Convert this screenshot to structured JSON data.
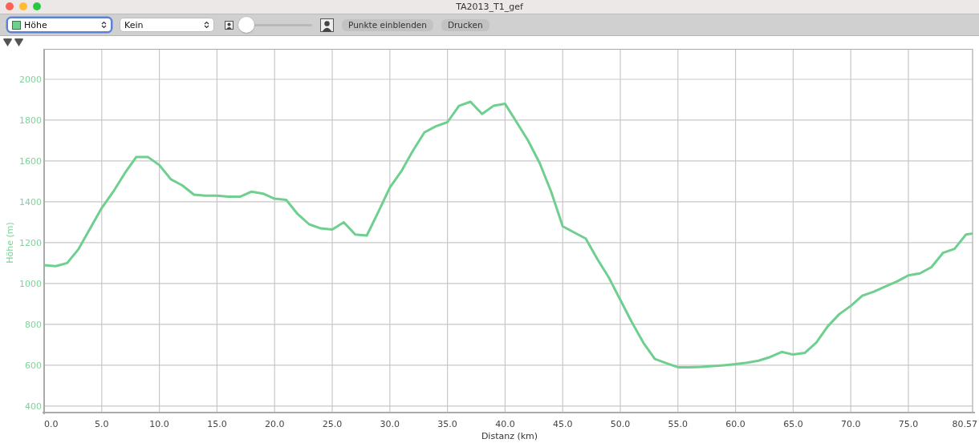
{
  "window": {
    "title": "TA2013_T1_gef"
  },
  "toolbar": {
    "smoothing_select": {
      "value": "Kein"
    },
    "zoom_slider": {
      "level": 0.0
    },
    "buttons": [
      "Punkte einblenden",
      "Drucken"
    ]
  },
  "chart_data": {
    "type": "line",
    "xlabel": "Distanz (km)",
    "ylabel": "Höhe (m)",
    "x": [
      0,
      1,
      2,
      3,
      4,
      5,
      6,
      7,
      8,
      9,
      10,
      11,
      12,
      13,
      14,
      15,
      16,
      17,
      18,
      19,
      20,
      21,
      22,
      23,
      24,
      25,
      26,
      27,
      28,
      29,
      30,
      31,
      32,
      33,
      34,
      35,
      36,
      37,
      38,
      39,
      40,
      41,
      42,
      43,
      44,
      45,
      46,
      47,
      48,
      49,
      50,
      51,
      52,
      53,
      54,
      55,
      56,
      57,
      58,
      59,
      60,
      61,
      62,
      63,
      64,
      65,
      66,
      67,
      68,
      69,
      70,
      71,
      72,
      73,
      74,
      75,
      76,
      77,
      78,
      79,
      80,
      80.57
    ],
    "series": [
      {
        "name": "Höhe",
        "color": "#6fcf8f",
        "values": [
          1090,
          1085,
          1100,
          1170,
          1270,
          1370,
          1450,
          1540,
          1620,
          1620,
          1580,
          1510,
          1480,
          1435,
          1430,
          1430,
          1425,
          1425,
          1450,
          1440,
          1415,
          1410,
          1340,
          1290,
          1270,
          1265,
          1300,
          1240,
          1235,
          1350,
          1470,
          1550,
          1650,
          1740,
          1770,
          1790,
          1870,
          1890,
          1830,
          1870,
          1880,
          1790,
          1700,
          1590,
          1450,
          1280,
          1250,
          1220,
          1120,
          1030,
          920,
          810,
          710,
          630,
          610,
          590,
          590,
          592,
          596,
          600,
          605,
          612,
          622,
          640,
          665,
          652,
          660,
          710,
          790,
          850,
          890,
          940,
          960,
          985,
          1010,
          1040,
          1050,
          1080,
          1150,
          1170,
          1240,
          1245
        ]
      }
    ],
    "grid": true,
    "xlim": [
      0,
      80.57
    ],
    "ylim": [
      372,
      2149
    ],
    "xticks": [
      {
        "value": 0,
        "label": "0.0"
      },
      {
        "value": 5,
        "label": "5.0"
      },
      {
        "value": 10,
        "label": "10.0"
      },
      {
        "value": 15,
        "label": "15.0"
      },
      {
        "value": 20,
        "label": "20.0"
      },
      {
        "value": 25,
        "label": "25.0"
      },
      {
        "value": 30,
        "label": "30.0"
      },
      {
        "value": 35,
        "label": "35.0"
      },
      {
        "value": 40,
        "label": "40.0"
      },
      {
        "value": 45,
        "label": "45.0"
      },
      {
        "value": 50,
        "label": "50.0"
      },
      {
        "value": 55,
        "label": "55.0"
      },
      {
        "value": 60,
        "label": "60.0"
      },
      {
        "value": 65,
        "label": "65.0"
      },
      {
        "value": 70,
        "label": "70.0"
      },
      {
        "value": 75,
        "label": "75.0"
      },
      {
        "value": 80.57,
        "label": "80.57"
      }
    ],
    "yticks": [
      400,
      600,
      800,
      1000,
      1200,
      1400,
      1600,
      1800,
      2000
    ]
  }
}
